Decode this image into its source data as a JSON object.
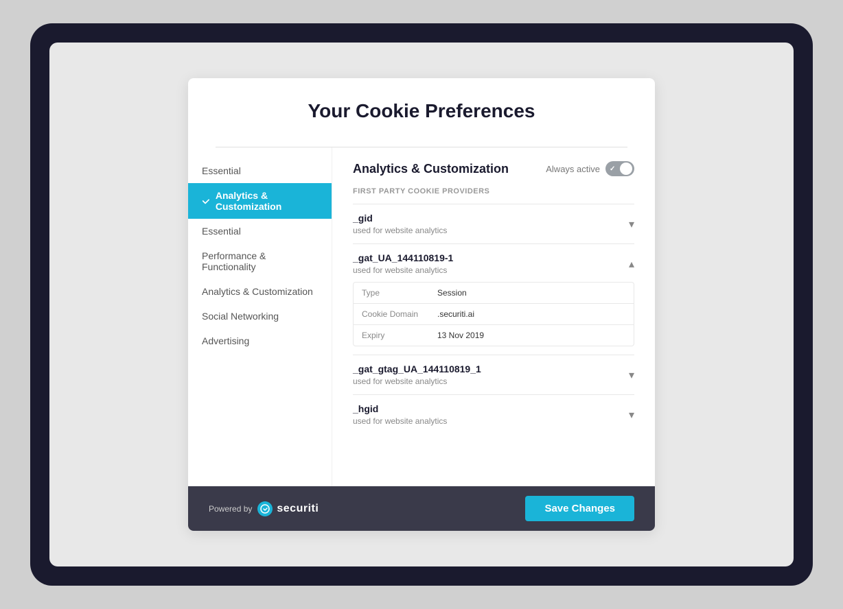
{
  "page": {
    "title": "Your Cookie Preferences"
  },
  "sidebar": {
    "items": [
      {
        "id": "essential-top",
        "label": "Essential",
        "active": false
      },
      {
        "id": "analytics-customization",
        "label": "Analytics & Customization",
        "active": true
      },
      {
        "id": "essential",
        "label": "Essential",
        "active": false
      },
      {
        "id": "performance-functionality",
        "label": "Performance & Functionality",
        "active": false
      },
      {
        "id": "analytics-customization-2",
        "label": "Analytics & Customization",
        "active": false
      },
      {
        "id": "social-networking",
        "label": "Social Networking",
        "active": false
      },
      {
        "id": "advertising",
        "label": "Advertising",
        "active": false
      }
    ]
  },
  "content": {
    "title": "Analytics & Customization",
    "always_active_label": "Always active",
    "section_label": "FIRST PARTY COOKIE PROVIDERS",
    "cookies": [
      {
        "id": "gid",
        "name": "_gid",
        "description": "used for website analytics",
        "expanded": false,
        "chevron": "▾",
        "details": []
      },
      {
        "id": "gat_ua",
        "name": "_gat_UA_144110819-1",
        "description": "used for website analytics",
        "expanded": true,
        "chevron": "▴",
        "details": [
          {
            "label": "Type",
            "value": "Session"
          },
          {
            "label": "Cookie Domain",
            "value": ".securiti.ai"
          },
          {
            "label": "Expiry",
            "value": "13 Nov 2019"
          }
        ]
      },
      {
        "id": "gat_gtag",
        "name": "_gat_gtag_UA_144110819_1",
        "description": "used for website analytics",
        "expanded": false,
        "chevron": "▾",
        "details": []
      },
      {
        "id": "hgid",
        "name": "_hgid",
        "description": "used for website analytics",
        "expanded": false,
        "chevron": "▾",
        "details": []
      }
    ]
  },
  "footer": {
    "powered_by_label": "Powered by",
    "brand_name": "securiti",
    "save_button_label": "Save Changes"
  }
}
